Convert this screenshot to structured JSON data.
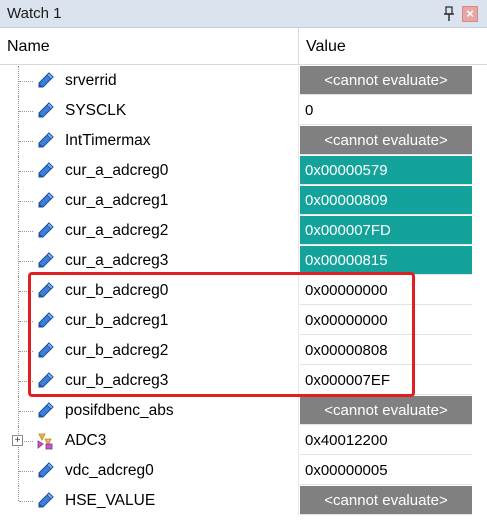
{
  "window": {
    "title": "Watch 1",
    "pin_icon": "pin-icon",
    "close_icon": "close-icon"
  },
  "columns": {
    "name": "Name",
    "value": "Value"
  },
  "colors": {
    "unevaluable": "#808080",
    "changed": "#13a39a",
    "highlight_box": "#e02020"
  },
  "rows": [
    {
      "name": "srverrid",
      "value": "<cannot evaluate>",
      "state": "gray",
      "icon": "variable-icon"
    },
    {
      "name": "SYSCLK",
      "value": "0",
      "state": "white",
      "icon": "variable-icon"
    },
    {
      "name": "IntTimermax",
      "value": "<cannot evaluate>",
      "state": "gray",
      "icon": "variable-icon"
    },
    {
      "name": "cur_a_adcreg0",
      "value": "0x00000579",
      "state": "teal",
      "icon": "variable-icon"
    },
    {
      "name": "cur_a_adcreg1",
      "value": "0x00000809",
      "state": "teal",
      "icon": "variable-icon"
    },
    {
      "name": "cur_a_adcreg2",
      "value": "0x000007FD",
      "state": "teal",
      "icon": "variable-icon"
    },
    {
      "name": "cur_a_adcreg3",
      "value": "0x00000815",
      "state": "teal",
      "icon": "variable-icon"
    },
    {
      "name": "cur_b_adcreg0",
      "value": "0x00000000",
      "state": "white",
      "icon": "variable-icon"
    },
    {
      "name": "cur_b_adcreg1",
      "value": "0x00000000",
      "state": "white",
      "icon": "variable-icon"
    },
    {
      "name": "cur_b_adcreg2",
      "value": "0x00000808",
      "state": "white",
      "icon": "variable-icon"
    },
    {
      "name": "cur_b_adcreg3",
      "value": "0x000007EF",
      "state": "white",
      "icon": "variable-icon"
    },
    {
      "name": "posifdbenc_abs",
      "value": "<cannot evaluate>",
      "state": "gray",
      "icon": "variable-icon"
    },
    {
      "name": "ADC3",
      "value": "0x40012200",
      "state": "white",
      "icon": "struct-icon",
      "expandable": true,
      "expander": "+"
    },
    {
      "name": "vdc_adcreg0",
      "value": "0x00000005",
      "state": "white",
      "icon": "variable-icon"
    },
    {
      "name": "HSE_VALUE",
      "value": "<cannot evaluate>",
      "state": "gray",
      "icon": "variable-icon"
    }
  ]
}
